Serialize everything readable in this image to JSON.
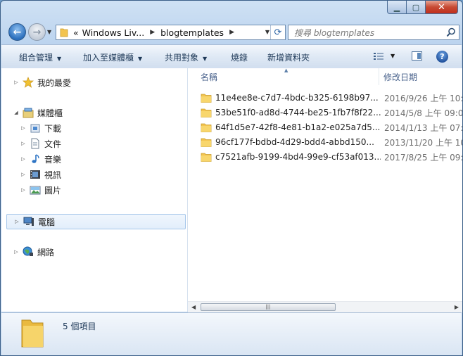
{
  "address": {
    "crumbs": [
      "Windows Liv...",
      "blogtemplates"
    ],
    "prefix": "«"
  },
  "search": {
    "placeholder": "搜尋 blogtemplates"
  },
  "toolbar": {
    "organize": "組合管理",
    "add_to_library": "加入至媒體櫃",
    "share_with": "共用對象",
    "burn": "燒錄",
    "new_folder": "新增資料夾"
  },
  "tree": {
    "favorites": "我的最愛",
    "libraries": "媒體櫃",
    "downloads": "下載",
    "documents": "文件",
    "music": "音樂",
    "videos": "視訊",
    "pictures": "圖片",
    "computer": "電腦",
    "network": "網路"
  },
  "columns": {
    "name": "名稱",
    "date_modified": "修改日期"
  },
  "files": [
    {
      "name": "11e4ee8e-c7d7-4bdc-b325-6198b97...",
      "date": "2016/9/26 上午 10:"
    },
    {
      "name": "53be51f0-ad8d-4744-be25-1fb7f8f22...",
      "date": "2014/5/8 上午 09:0"
    },
    {
      "name": "64f1d5e7-42f8-4e81-b1a2-e025a7d5...",
      "date": "2014/1/13 上午 07:"
    },
    {
      "name": "96cf177f-bdbd-4d29-bdd4-abbd150...",
      "date": "2013/11/20 上午 10"
    },
    {
      "name": "c7521afb-9199-4bd4-99e9-cf53af013...",
      "date": "2017/8/25 上午 09:"
    }
  ],
  "status": {
    "item_count": "5 個項目"
  },
  "colors": {
    "accent": "#2b6fbd",
    "folder": "#f3c44f",
    "selection": "#e2eefb"
  }
}
